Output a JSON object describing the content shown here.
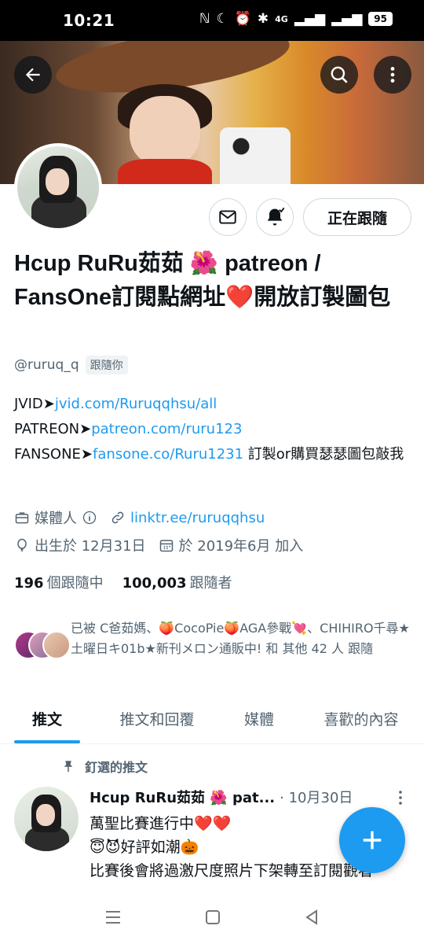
{
  "status_bar": {
    "time": "10:21",
    "network": "4G",
    "battery": "95"
  },
  "profile": {
    "display_name": "Hcup RuRu茹茹 🌺 patreon / FansOne訂閱點網址❤️開放訂製圖包",
    "handle": "@ruruq_q",
    "follows_you": "跟隨你",
    "follow_button": "正在跟隨",
    "bio_lines": [
      {
        "prefix": "JVID➤",
        "link": "jvid.com/Ruruqqhsu/all",
        "suffix": ""
      },
      {
        "prefix": "PATREON➤",
        "link": "patreon.com/ruru123",
        "suffix": ""
      },
      {
        "prefix": "FANSONE➤",
        "link": "fansone.co/Ruru1231",
        "suffix": " 訂製or購買瑟瑟圖包敲我"
      }
    ],
    "category": "媒體人",
    "website": "linktr.ee/ruruqqhsu",
    "birthday": "出生於 12月31日",
    "joined": "於 2019年6月 加入",
    "following_count": "196",
    "following_label": "個跟隨中",
    "followers_count": "100,003",
    "followers_label": "跟隨者",
    "followed_by_text": "已被 C爸茹媽、🍑CocoPie🍑AGA參戰💘、CHIHIRO千尋★土曜日キ01b★新刊メロン通販中! 和 其他 42 人 跟隨"
  },
  "tabs": [
    {
      "label": "推文",
      "active": true
    },
    {
      "label": "推文和回覆",
      "active": false
    },
    {
      "label": "媒體",
      "active": false
    },
    {
      "label": "喜歡的內容",
      "active": false
    }
  ],
  "pinned_tweet": {
    "pinned_label": "釘選的推文",
    "author": "Hcup RuRu茹茹 🌺 pat...",
    "date": "· 10月30日",
    "line1": "萬聖比賽進行中❤️❤️",
    "line2": "😇😈好評如潮🎃",
    "line3": "比賽後會將過激尺度照片下架轉至訂閱觀看"
  },
  "colors": {
    "accent": "#1d9bf0",
    "text_primary": "#0f1419",
    "text_secondary": "#536471"
  }
}
